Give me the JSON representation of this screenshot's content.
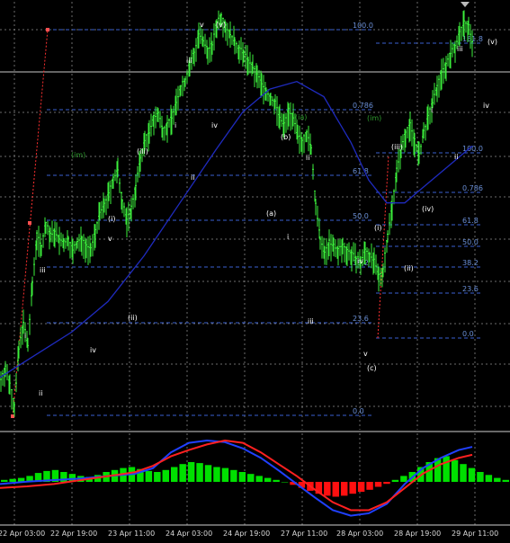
{
  "colors": {
    "background": "#000000",
    "grid": "#9a9a9a",
    "candle": "#3cf03c",
    "ma": "#1f2bbf",
    "fib": "#3a5fd0",
    "fib_text": "#6a8fd6",
    "wave_label": "#ffffff",
    "wave_label_alt": "#2f9e2f",
    "macd_fast": "#ff2020",
    "macd_slow": "#2040ff",
    "hist_pos": "#00e000",
    "hist_neg": "#ff1010",
    "trend_line": "#ff3030"
  },
  "chart_data": {
    "type": "candlestick",
    "title": "",
    "xlabel": "",
    "ylabel": "",
    "grid": true,
    "time_labels": [
      "22 Apr 03:00",
      "22 Apr 19:00",
      "23 Apr 11:00",
      "24 Apr 03:00",
      "24 Apr 19:00",
      "27 Apr 11:00",
      "28 Apr 03:00",
      "28 Apr 19:00",
      "29 Apr 11:00"
    ],
    "fib_left": [
      "100.0",
      "0.786",
      "61.8",
      "50.0",
      "38.2",
      "23.6",
      "0.0"
    ],
    "fib_right": [
      "161.8",
      "100.0",
      "0.786",
      "61.8",
      "50.0",
      "38.2",
      "23.6",
      "0.0"
    ],
    "wave_labels": [
      "i",
      "ii",
      "iii",
      "iv",
      "v",
      "(i)",
      "(ii)",
      "(iii)",
      "i",
      "ii",
      "iii",
      "iv",
      "v",
      "(v)",
      "(a)",
      "(b)",
      "i",
      "ii",
      "iii",
      "iv",
      "v",
      "(c)",
      "(i)",
      "(ii)",
      "(iii)",
      "(iv)",
      "i",
      "ii",
      "iii",
      "iv",
      "(v)"
    ],
    "wave_labels_alt": [
      "(im)",
      "(im)",
      "(ia)"
    ],
    "close_price_path": [
      [
        0,
        0.09
      ],
      [
        5,
        0.12
      ],
      [
        10,
        0.08
      ],
      [
        15,
        0.02
      ],
      [
        20,
        0.17
      ],
      [
        25,
        0.24
      ],
      [
        30,
        0.18
      ],
      [
        35,
        0.34
      ],
      [
        40,
        0.47
      ],
      [
        45,
        0.44
      ],
      [
        50,
        0.5
      ],
      [
        55,
        0.47
      ],
      [
        60,
        0.48
      ],
      [
        65,
        0.46
      ],
      [
        70,
        0.45
      ],
      [
        75,
        0.46
      ],
      [
        80,
        0.43
      ],
      [
        85,
        0.45
      ],
      [
        90,
        0.46
      ],
      [
        95,
        0.44
      ],
      [
        100,
        0.43
      ],
      [
        105,
        0.48
      ],
      [
        110,
        0.53
      ],
      [
        115,
        0.55
      ],
      [
        120,
        0.58
      ],
      [
        125,
        0.62
      ],
      [
        130,
        0.64
      ],
      [
        135,
        0.56
      ],
      [
        140,
        0.51
      ],
      [
        145,
        0.54
      ],
      [
        150,
        0.6
      ],
      [
        155,
        0.67
      ],
      [
        160,
        0.72
      ],
      [
        165,
        0.74
      ],
      [
        170,
        0.78
      ],
      [
        175,
        0.79
      ],
      [
        180,
        0.75
      ],
      [
        185,
        0.76
      ],
      [
        190,
        0.78
      ],
      [
        195,
        0.82
      ],
      [
        200,
        0.86
      ],
      [
        205,
        0.88
      ],
      [
        210,
        0.92
      ],
      [
        215,
        0.95
      ],
      [
        220,
        1.0
      ],
      [
        225,
        0.98
      ],
      [
        230,
        0.96
      ],
      [
        235,
        0.97
      ],
      [
        240,
        1.03
      ],
      [
        245,
        1.05
      ],
      [
        250,
        1.02
      ],
      [
        255,
        1.0
      ],
      [
        260,
        0.98
      ],
      [
        265,
        0.96
      ],
      [
        270,
        0.95
      ],
      [
        275,
        0.93
      ],
      [
        280,
        0.91
      ],
      [
        285,
        0.89
      ],
      [
        290,
        0.87
      ],
      [
        295,
        0.85
      ],
      [
        300,
        0.83
      ],
      [
        305,
        0.82
      ],
      [
        310,
        0.78
      ],
      [
        315,
        0.76
      ],
      [
        320,
        0.8
      ],
      [
        325,
        0.78
      ],
      [
        330,
        0.73
      ],
      [
        335,
        0.72
      ],
      [
        340,
        0.74
      ],
      [
        345,
        0.7
      ],
      [
        350,
        0.55
      ],
      [
        355,
        0.46
      ],
      [
        360,
        0.42
      ],
      [
        365,
        0.45
      ],
      [
        370,
        0.44
      ],
      [
        375,
        0.43
      ],
      [
        380,
        0.44
      ],
      [
        385,
        0.43
      ],
      [
        390,
        0.42
      ],
      [
        395,
        0.41
      ],
      [
        400,
        0.4
      ],
      [
        405,
        0.43
      ],
      [
        410,
        0.42
      ],
      [
        415,
        0.4
      ],
      [
        420,
        0.36
      ],
      [
        425,
        0.38
      ],
      [
        430,
        0.47
      ],
      [
        435,
        0.55
      ],
      [
        440,
        0.64
      ],
      [
        445,
        0.7
      ],
      [
        450,
        0.74
      ],
      [
        455,
        0.76
      ],
      [
        460,
        0.72
      ],
      [
        465,
        0.68
      ],
      [
        470,
        0.74
      ],
      [
        475,
        0.78
      ],
      [
        480,
        0.82
      ],
      [
        485,
        0.86
      ],
      [
        490,
        0.9
      ],
      [
        495,
        0.92
      ],
      [
        500,
        0.95
      ],
      [
        505,
        0.97
      ],
      [
        510,
        1.0
      ],
      [
        515,
        1.03
      ],
      [
        520,
        1.02
      ],
      [
        525,
        0.97
      ]
    ],
    "ma_path": [
      [
        0,
        0.1
      ],
      [
        40,
        0.16
      ],
      [
        80,
        0.22
      ],
      [
        120,
        0.3
      ],
      [
        160,
        0.42
      ],
      [
        200,
        0.56
      ],
      [
        240,
        0.7
      ],
      [
        270,
        0.8
      ],
      [
        300,
        0.86
      ],
      [
        330,
        0.88
      ],
      [
        360,
        0.84
      ],
      [
        390,
        0.72
      ],
      [
        410,
        0.62
      ],
      [
        430,
        0.56
      ],
      [
        450,
        0.56
      ],
      [
        470,
        0.6
      ],
      [
        500,
        0.66
      ],
      [
        525,
        0.71
      ]
    ],
    "macd_fast": [
      [
        0,
        0.4
      ],
      [
        30,
        0.42
      ],
      [
        60,
        0.45
      ],
      [
        90,
        0.5
      ],
      [
        120,
        0.55
      ],
      [
        150,
        0.6
      ],
      [
        170,
        0.68
      ],
      [
        190,
        0.8
      ],
      [
        210,
        0.88
      ],
      [
        230,
        0.95
      ],
      [
        250,
        1.0
      ],
      [
        270,
        0.97
      ],
      [
        290,
        0.85
      ],
      [
        310,
        0.7
      ],
      [
        330,
        0.55
      ],
      [
        350,
        0.38
      ],
      [
        370,
        0.22
      ],
      [
        390,
        0.12
      ],
      [
        410,
        0.12
      ],
      [
        430,
        0.22
      ],
      [
        450,
        0.4
      ],
      [
        470,
        0.58
      ],
      [
        490,
        0.7
      ],
      [
        510,
        0.78
      ],
      [
        525,
        0.82
      ]
    ],
    "macd_slow": [
      [
        0,
        0.45
      ],
      [
        30,
        0.48
      ],
      [
        60,
        0.5
      ],
      [
        90,
        0.52
      ],
      [
        120,
        0.55
      ],
      [
        150,
        0.58
      ],
      [
        170,
        0.65
      ],
      [
        190,
        0.85
      ],
      [
        210,
        0.97
      ],
      [
        230,
        1.0
      ],
      [
        250,
        0.98
      ],
      [
        270,
        0.9
      ],
      [
        290,
        0.78
      ],
      [
        310,
        0.62
      ],
      [
        330,
        0.45
      ],
      [
        350,
        0.28
      ],
      [
        370,
        0.12
      ],
      [
        390,
        0.05
      ],
      [
        410,
        0.08
      ],
      [
        430,
        0.2
      ],
      [
        450,
        0.45
      ],
      [
        470,
        0.65
      ],
      [
        490,
        0.78
      ],
      [
        510,
        0.88
      ],
      [
        525,
        0.92
      ]
    ],
    "histogram": [
      0.02,
      0.03,
      0.04,
      0.06,
      0.09,
      0.11,
      0.12,
      0.1,
      0.08,
      0.06,
      0.05,
      0.07,
      0.1,
      0.12,
      0.14,
      0.15,
      0.13,
      0.11,
      0.1,
      0.12,
      0.15,
      0.18,
      0.2,
      0.19,
      0.17,
      0.15,
      0.14,
      0.12,
      0.1,
      0.08,
      0.06,
      0.04,
      0.02,
      0.0,
      -0.03,
      -0.06,
      -0.09,
      -0.12,
      -0.14,
      -0.15,
      -0.14,
      -0.12,
      -0.1,
      -0.08,
      -0.05,
      -0.02,
      0.02,
      0.06,
      0.1,
      0.15,
      0.2,
      0.24,
      0.26,
      0.22,
      0.18,
      0.14,
      0.1,
      0.07,
      0.04,
      0.02
    ]
  }
}
